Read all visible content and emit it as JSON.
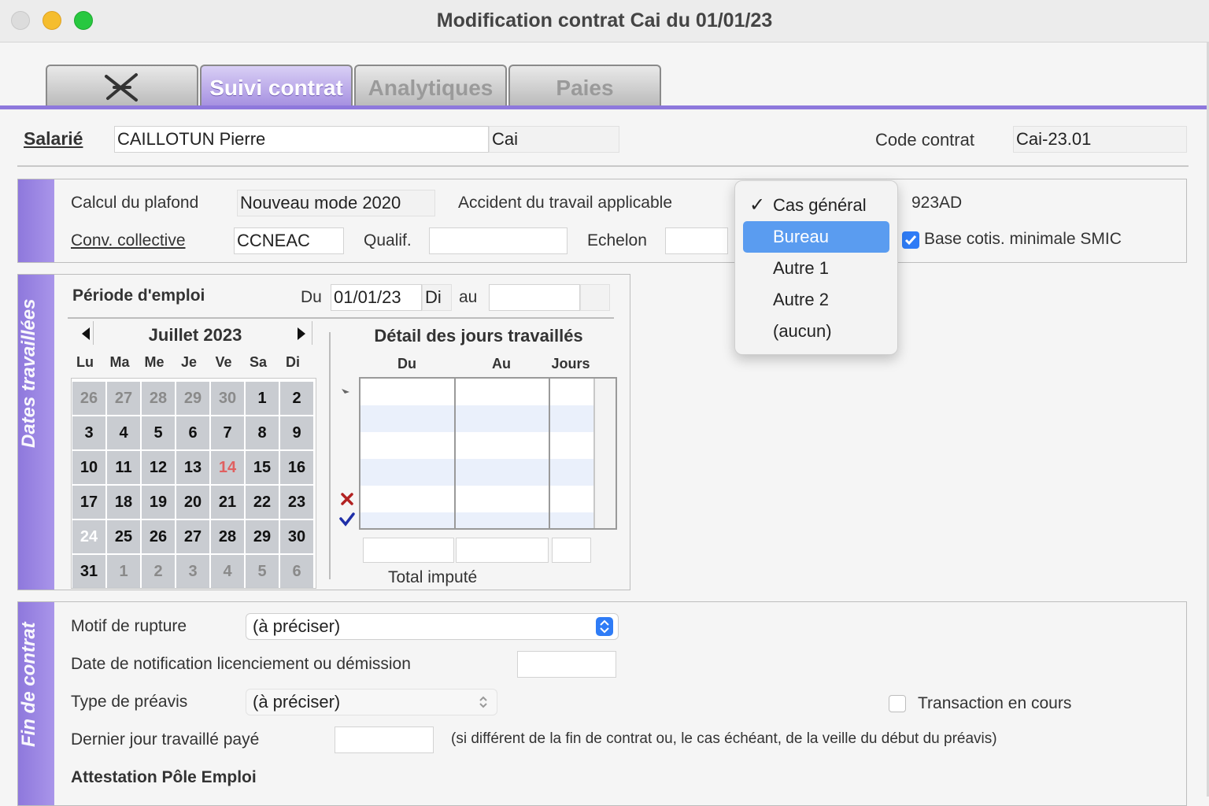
{
  "window": {
    "title": "Modification contrat Cai du 01/01/23"
  },
  "tabs": [
    {
      "label": "",
      "icon": "tools-icon"
    },
    {
      "label": "Suivi contrat"
    },
    {
      "label": "Analytiques"
    },
    {
      "label": "Paies"
    }
  ],
  "header": {
    "salarie_label": "Salarié",
    "salarie_name": "CAILLOTUN Pierre",
    "salarie_code": "Cai",
    "code_contrat_label": "Code contrat",
    "code_contrat_value": "Cai-23.01"
  },
  "plafond": {
    "calcul_label": "Calcul du plafond",
    "calcul_value": "Nouveau mode 2020",
    "accident_label": "Accident du travail applicable",
    "accident_code": "923AD",
    "conv_label": "Conv. collective",
    "conv_value": "CCNEAC",
    "qualif_label": "Qualif.",
    "qualif_value": "",
    "echelon_label": "Echelon",
    "echelon_value": "",
    "smic_label": "Base cotis. minimale SMIC"
  },
  "dropdown": {
    "items": [
      "Cas général",
      "Bureau",
      "Autre 1",
      "Autre 2",
      "(aucun)"
    ],
    "checked_index": 0,
    "highlighted_index": 1
  },
  "dates": {
    "section_label": "Dates travaillées",
    "periode_label": "Période d'emploi",
    "du_label": "Du",
    "du_value": "01/01/23",
    "du_day": "Di",
    "au_label": "au",
    "au_value": "",
    "calendar_title": "Juillet 2023",
    "weekdays": [
      "Lu",
      "Ma",
      "Me",
      "Je",
      "Ve",
      "Sa",
      "Di"
    ],
    "weeks": [
      [
        "26",
        "27",
        "28",
        "29",
        "30",
        "1",
        "2"
      ],
      [
        "3",
        "4",
        "5",
        "6",
        "7",
        "8",
        "9"
      ],
      [
        "10",
        "11",
        "12",
        "13",
        "14",
        "15",
        "16"
      ],
      [
        "17",
        "18",
        "19",
        "20",
        "21",
        "22",
        "23"
      ],
      [
        "24",
        "25",
        "26",
        "27",
        "28",
        "29",
        "30"
      ],
      [
        "31",
        "1",
        "2",
        "3",
        "4",
        "5",
        "6"
      ]
    ],
    "detail_title": "Détail des jours travaillés",
    "detail_columns": [
      "Du",
      "Au",
      "Jours"
    ],
    "total_label": "Total imputé"
  },
  "fin": {
    "section_label": "Fin de contrat",
    "motif_label": "Motif de rupture",
    "motif_value": "(à préciser)",
    "notif_label": "Date de notification licenciement ou démission",
    "preavis_label": "Type de préavis",
    "preavis_value": "(à préciser)",
    "transaction_label": "Transaction en cours",
    "dernier_label": "Dernier jour travaillé payé",
    "dernier_note": "(si différent de la fin de contrat ou, le cas échéant, de la veille du début du préavis)",
    "attestation_label": "Attestation Pôle Emploi"
  },
  "colors": {
    "accent": "#8e78dc",
    "selection": "#5a9cf0",
    "close": "#dcdcdc",
    "minimize": "#f5bd2e",
    "zoom": "#28c840"
  }
}
